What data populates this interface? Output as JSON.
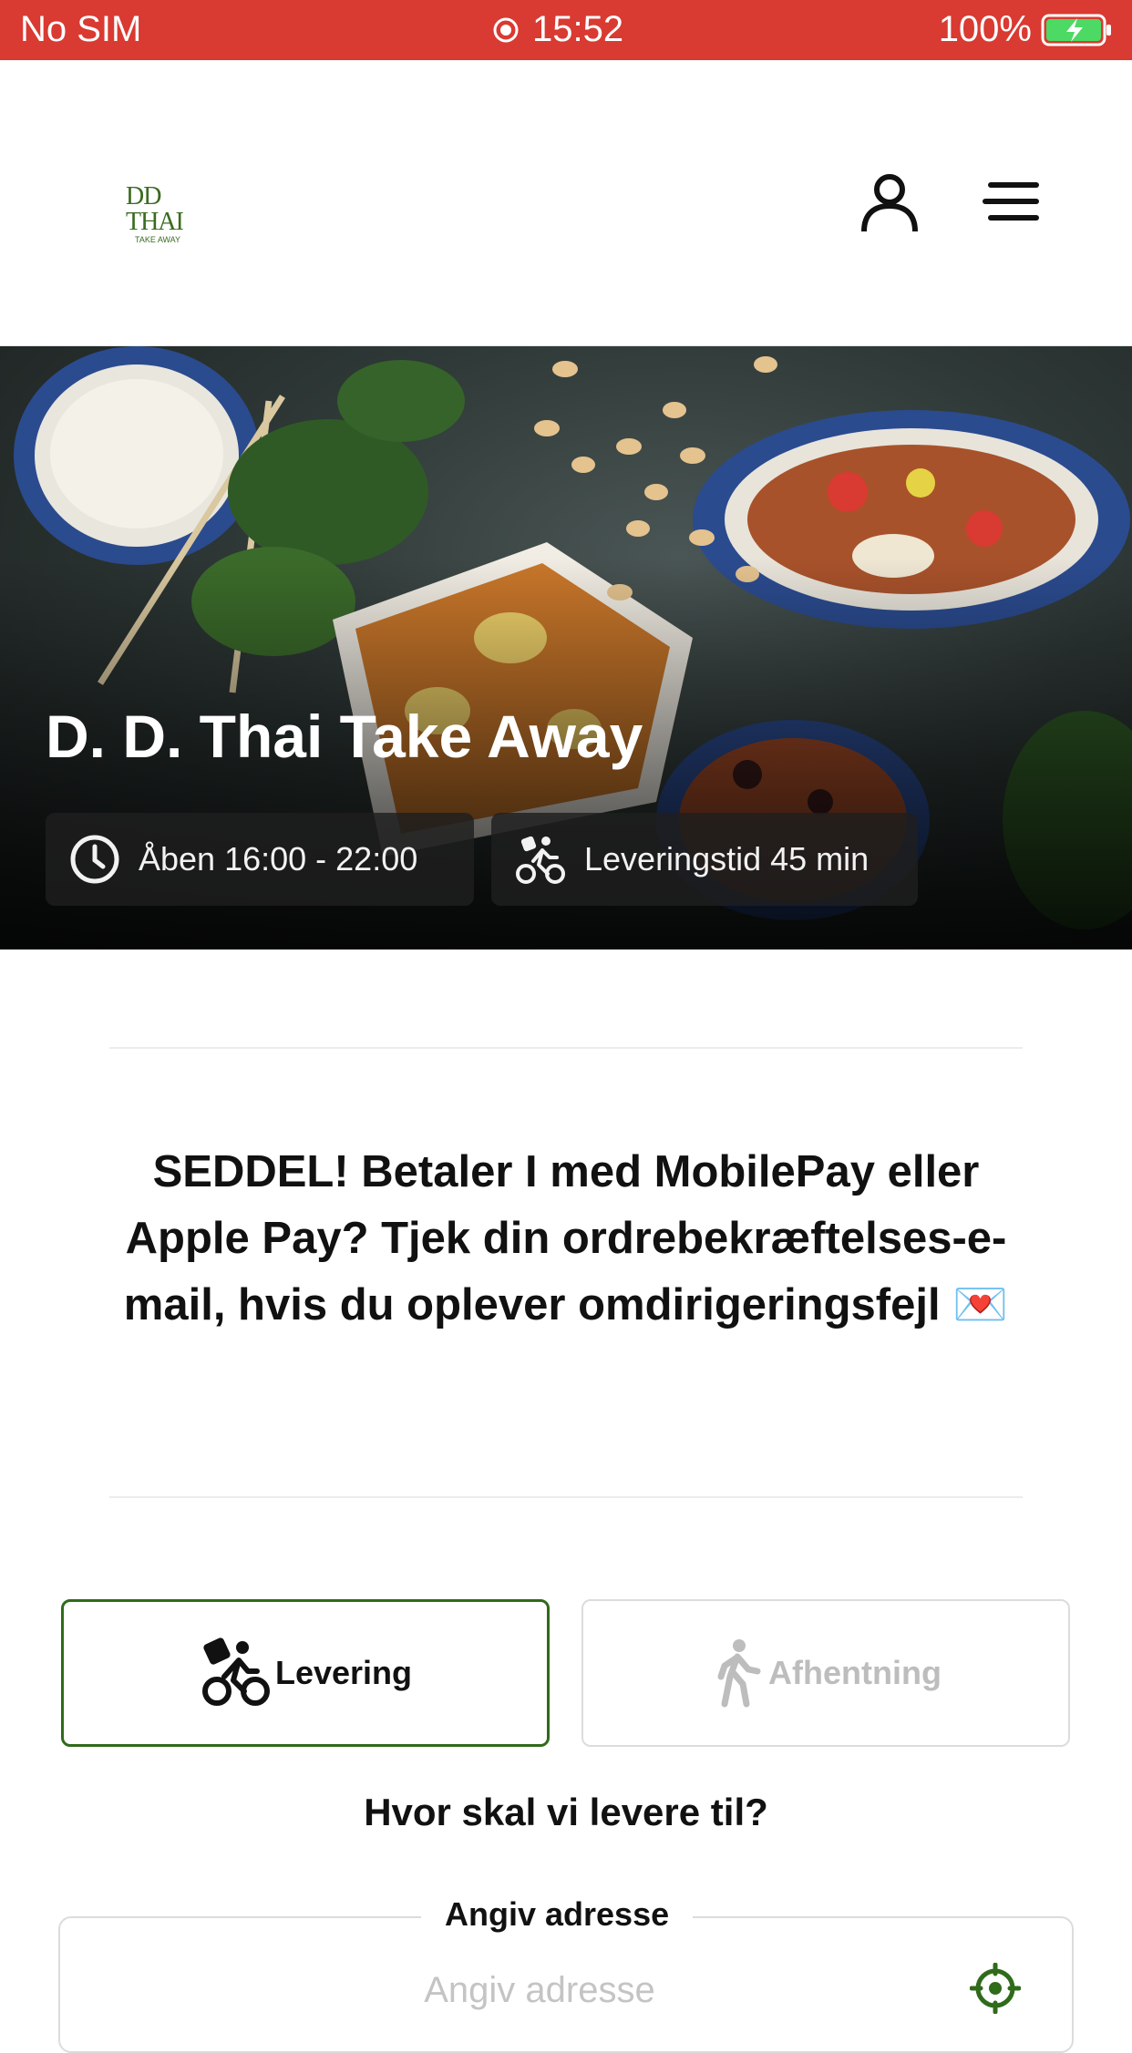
{
  "status_bar": {
    "carrier": "No SIM",
    "time": "15:52",
    "battery": "100%"
  },
  "header": {
    "logo_text": "DD THAI",
    "logo_subtext": "TAKE AWAY"
  },
  "hero": {
    "restaurant_name": "D. D. Thai Take Away",
    "hours": "Åben 16:00 - 22:00",
    "delivery_time": "Leveringstid 45 min"
  },
  "notice": {
    "text": "SEDDEL! Betaler I med MobilePay eller Apple Pay? Tjek din ordrebekræftelses-e-mail, hvis du oplever omdirigeringsfejl 💌"
  },
  "order_mode": {
    "delivery_label": "Levering",
    "pickup_label": "Afhentning",
    "selected": "Levering"
  },
  "address": {
    "question": "Hvor skal vi levere til?",
    "label": "Angiv adresse",
    "placeholder": "Angiv adresse",
    "value": ""
  },
  "colors": {
    "status_bar": "#d93a31",
    "accent_green": "#2f6b1a"
  },
  "icons": [
    "recording-icon",
    "battery-charging-icon",
    "user-icon",
    "menu-icon",
    "clock-icon",
    "bike-delivery-icon",
    "walking-icon",
    "locate-icon"
  ]
}
